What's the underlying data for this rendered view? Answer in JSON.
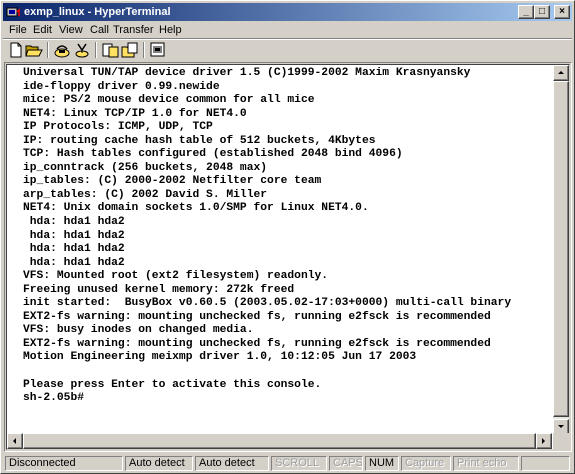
{
  "window": {
    "title": "exmp_linux - HyperTerminal"
  },
  "caption_buttons": {
    "minimize": "_",
    "maximize": "□",
    "close": "×"
  },
  "menu": [
    "File",
    "Edit",
    "View",
    "Call",
    "Transfer",
    "Help"
  ],
  "toolbar": {
    "buttons": [
      "new-icon",
      "open-icon",
      "connect-icon",
      "disconnect-icon",
      "send-icon",
      "receive-icon",
      "properties-icon"
    ]
  },
  "terminal": {
    "lines": [
      "Universal TUN/TAP device driver 1.5 (C)1999-2002 Maxim Krasnyansky",
      "ide-floppy driver 0.99.newide",
      "mice: PS/2 mouse device common for all mice",
      "NET4: Linux TCP/IP 1.0 for NET4.0",
      "IP Protocols: ICMP, UDP, TCP",
      "IP: routing cache hash table of 512 buckets, 4Kbytes",
      "TCP: Hash tables configured (established 2048 bind 4096)",
      "ip_conntrack (256 buckets, 2048 max)",
      "ip_tables: (C) 2000-2002 Netfilter core team",
      "arp_tables: (C) 2002 David S. Miller",
      "NET4: Unix domain sockets 1.0/SMP for Linux NET4.0.",
      " hda: hda1 hda2",
      " hda: hda1 hda2",
      " hda: hda1 hda2",
      " hda: hda1 hda2",
      "VFS: Mounted root (ext2 filesystem) readonly.",
      "Freeing unused kernel memory: 272k freed",
      "init started:  BusyBox v0.60.5 (2003.05.02-17:03+0000) multi-call binary",
      "EXT2-fs warning: mounting unchecked fs, running e2fsck is recommended",
      "VFS: busy inodes on changed media.",
      "EXT2-fs warning: mounting unchecked fs, running e2fsck is recommended",
      "Motion Engineering meixmp driver 1.0, 10:12:05 Jun 17 2003",
      "",
      "Please press Enter to activate this console.",
      "sh-2.05b#"
    ]
  },
  "status": {
    "connection": "Disconnected",
    "detect1": "Auto detect",
    "detect2": "Auto detect",
    "scroll": "SCROLL",
    "caps": "CAPS",
    "num": "NUM",
    "capture": "Capture",
    "print_echo": "Print echo"
  }
}
